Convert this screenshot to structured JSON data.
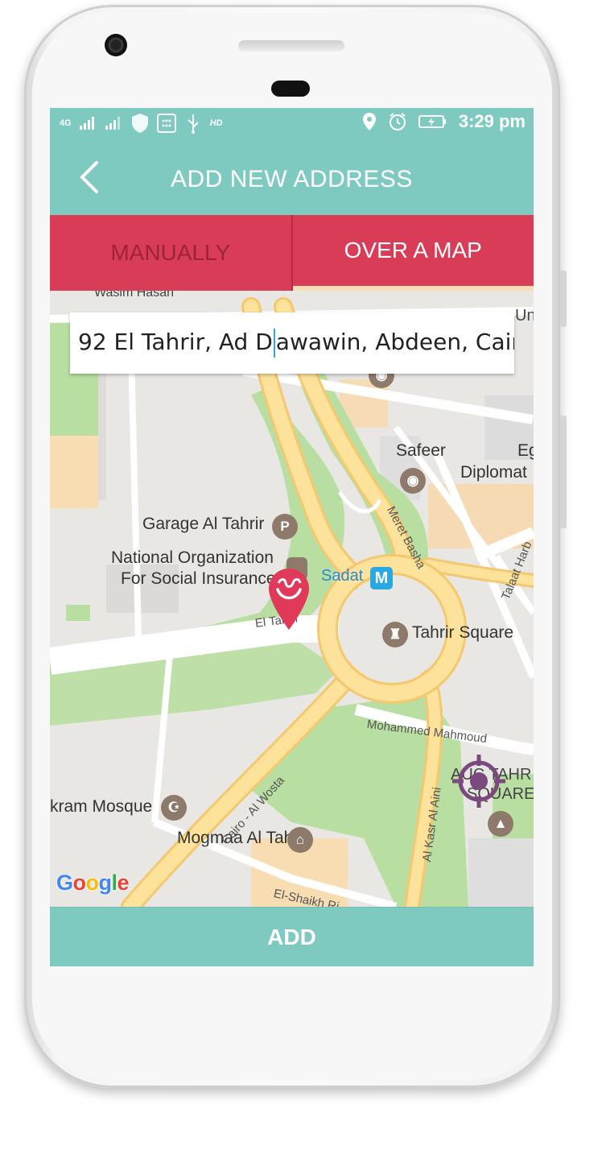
{
  "status_bar": {
    "network_label": "4G",
    "hd_label": "HD",
    "time": "3:29 pm"
  },
  "app_bar": {
    "title": "ADD NEW ADDRESS",
    "back_icon": "chevron-left-icon"
  },
  "tabs": [
    {
      "label": "MANUALLY",
      "selected": false
    },
    {
      "label": "OVER A MAP",
      "selected": true
    }
  ],
  "search": {
    "value_before_caret": "92 El Tahrir, Ad D",
    "value_after_caret": "awawin, Abdeen, Cairo"
  },
  "map": {
    "places": {
      "wasim": "Wasim Hasan",
      "uni": "Uni",
      "safeer": "Safeer",
      "eg": "Eg",
      "diplomat": "Diplomat",
      "garage": "Garage Al Tahrir",
      "national_1": "National Organization",
      "national_2": "For Social Insurance",
      "sadat": "Sadat",
      "tahrir_square": "Tahrir Square",
      "ikram": "kram Mosque",
      "mogmaa": "Mogmaa Al Tahrir",
      "auc_1": "AUC TAHR",
      "auc_2": "SQUARE"
    },
    "streets": {
      "el_tahrir": "El Tahrir",
      "meret_basha": "Meret Basha",
      "talaat": "Talaat Harb",
      "mohammed": "Mohammed Mahmoud",
      "cairo_wosta": "Cairo - Al Wosta",
      "kasr": "Al Kasr Al Aini",
      "shaikh": "El-Shaikh Ri"
    },
    "metro_letter": "M",
    "parking_letter": "P",
    "attribution": [
      "G",
      "o",
      "o",
      "g",
      "l",
      "e"
    ],
    "colors": {
      "park": "#b9dea1",
      "road_major": "#fce29a",
      "road_border": "#f4c86e",
      "road_minor": "#ffffff",
      "block": "#f8ddb2",
      "poi": "#8e7a6b",
      "pin": "#e0395a",
      "locate": "#7a4a7e"
    }
  },
  "add_button": {
    "label": "ADD"
  }
}
